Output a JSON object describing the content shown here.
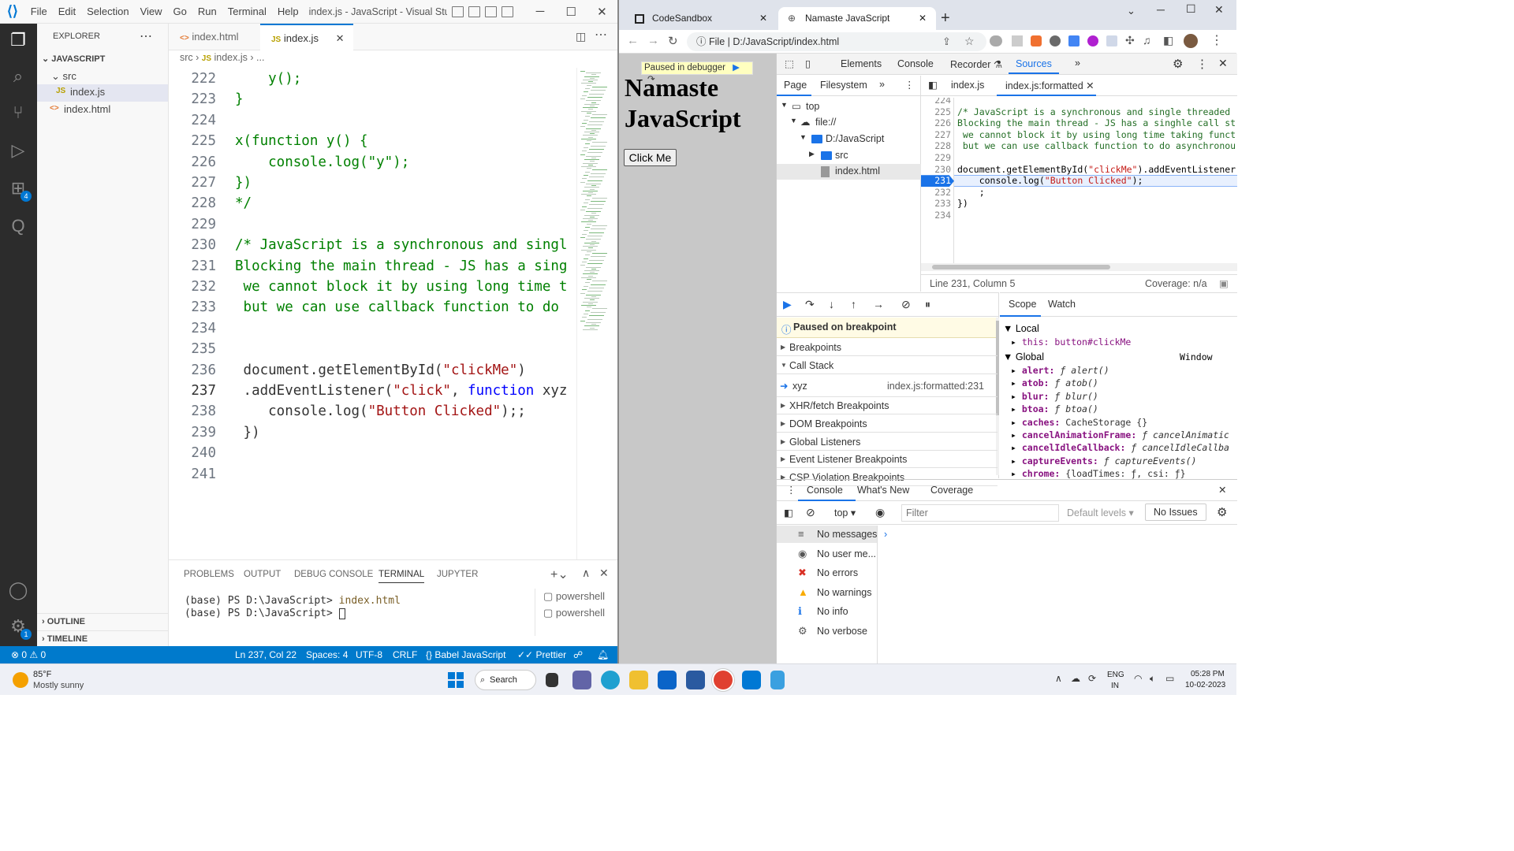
{
  "vscode": {
    "menu": [
      "File",
      "Edit",
      "Selection",
      "View",
      "Go",
      "Run",
      "Terminal",
      "Help"
    ],
    "window_title": "index.js - JavaScript - Visual Studio ...",
    "explorer_title": "EXPLORER",
    "workspace": "JAVASCRIPT",
    "folder": "src",
    "files": [
      "index.js",
      "index.html"
    ],
    "outline": "OUTLINE",
    "timeline": "TIMELINE",
    "badges": {
      "extensions": "4",
      "settings": "1"
    },
    "tabs": [
      {
        "label": "index.html",
        "icon": "<>"
      },
      {
        "label": "index.js",
        "icon": "JS"
      }
    ],
    "breadcrumb": {
      "folder": "src",
      "file": "index.js",
      "rest": "..."
    },
    "code_lines": [
      {
        "n": "222",
        "text": "    y();"
      },
      {
        "n": "223",
        "text": "}"
      },
      {
        "n": "224",
        "text": ""
      },
      {
        "n": "225",
        "text": "x(function y() {"
      },
      {
        "n": "226",
        "text": "    console.log(\"y\");"
      },
      {
        "n": "227",
        "text": "})"
      },
      {
        "n": "228",
        "text": "*/"
      },
      {
        "n": "229",
        "text": ""
      },
      {
        "n": "230",
        "text": "/* JavaScript is a synchronous and singl"
      },
      {
        "n": "231",
        "text": "Blocking the main thread - JS has a sing"
      },
      {
        "n": "232",
        "text": " we cannot block it by using long time t"
      },
      {
        "n": "233",
        "text": " but we can use callback function to do"
      },
      {
        "n": "234",
        "text": ""
      },
      {
        "n": "235",
        "text": ""
      },
      {
        "n": "236",
        "text": " document.getElementById(\"clickMe\")"
      },
      {
        "n": "237",
        "text": " .addEventListener(\"click\", function xyz"
      },
      {
        "n": "238",
        "text": "    console.log(\"Button Clicked\");;"
      },
      {
        "n": "239",
        "text": " })"
      },
      {
        "n": "240",
        "text": ""
      },
      {
        "n": "241",
        "text": ""
      }
    ],
    "panel_tabs": [
      "PROBLEMS",
      "OUTPUT",
      "DEBUG CONSOLE",
      "TERMINAL",
      "JUPYTER"
    ],
    "terminal_lines": [
      {
        "prompt": "(base) PS D:\\JavaScript>",
        "cmd": "index.html"
      },
      {
        "prompt": "(base) PS D:\\JavaScript>",
        "cmd": ""
      }
    ],
    "terminal_instances": [
      "powershell",
      "powershell"
    ],
    "status": {
      "errors": "0",
      "warnings": "0",
      "position": "Ln 237, Col 22",
      "spaces": "Spaces: 4",
      "encoding": "UTF-8",
      "eol": "CRLF",
      "language": "Babel JavaScript",
      "formatter": "Prettier"
    }
  },
  "chrome": {
    "tabs": [
      {
        "label": "CodeSandbox"
      },
      {
        "label": "Namaste JavaScript"
      }
    ],
    "url_scheme": "File",
    "url": "D:/JavaScript/index.html",
    "page": {
      "paused_banner": "Paused in debugger",
      "heading": "Namaste JavaScript",
      "button": "Click Me"
    },
    "devtools": {
      "tabs": [
        "Elements",
        "Console",
        "Recorder",
        "Sources"
      ],
      "nav_tabs": [
        "Page",
        "Filesystem"
      ],
      "tree": [
        "top",
        "file://",
        "D:/JavaScript",
        "src",
        "index.html"
      ],
      "file_tabs": [
        "index.js",
        "index.js:formatted"
      ],
      "src_lines": [
        {
          "n": "224",
          "text": ""
        },
        {
          "n": "225",
          "text": "/* JavaScript is a synchronous and single threaded"
        },
        {
          "n": "226",
          "text": "Blocking the main thread - JS has a singhle call st"
        },
        {
          "n": "227",
          "text": " we cannot block it by using long time taking funct"
        },
        {
          "n": "228",
          "text": " but we can use callback function to do asynchronou"
        },
        {
          "n": "229",
          "text": ""
        },
        {
          "n": "230",
          "text": "document.getElementById(\"clickMe\").addEventListener"
        },
        {
          "n": "231",
          "text": "    console.log(\"Button Clicked\");"
        },
        {
          "n": "232",
          "text": "    ;"
        },
        {
          "n": "233",
          "text": "})"
        },
        {
          "n": "234",
          "text": ""
        }
      ],
      "cursor_status": "Line 231, Column 5",
      "coverage": "Coverage: n/a",
      "paused_msg": "Paused on breakpoint",
      "sections": [
        "Breakpoints",
        "Call Stack",
        "XHR/fetch Breakpoints",
        "DOM Breakpoints",
        "Global Listeners",
        "Event Listener Breakpoints",
        "CSP Violation Breakpoints"
      ],
      "call_stack_frame": {
        "name": "xyz",
        "location": "index.js:formatted:231"
      },
      "scope_tabs": [
        "Scope",
        "Watch"
      ],
      "scope": {
        "local_label": "Local",
        "this_key": "this:",
        "this_val": "button#clickMe",
        "global_label": "Global",
        "global_val": "Window",
        "entries": [
          {
            "k": "alert:",
            "v": "ƒ alert()"
          },
          {
            "k": "atob:",
            "v": "ƒ atob()"
          },
          {
            "k": "blur:",
            "v": "ƒ blur()"
          },
          {
            "k": "btoa:",
            "v": "ƒ btoa()"
          },
          {
            "k": "caches:",
            "v": "CacheStorage {}"
          },
          {
            "k": "cancelAnimationFrame:",
            "v": "ƒ cancelAnimatic"
          },
          {
            "k": "cancelIdleCallback:",
            "v": "ƒ cancelIdleCallba"
          },
          {
            "k": "captureEvents:",
            "v": "ƒ captureEvents()"
          },
          {
            "k": "chrome:",
            "v": "{loadTimes: ƒ, csi: ƒ}"
          }
        ]
      },
      "drawer_tabs": [
        "Console",
        "What's New",
        "Coverage"
      ],
      "console_context": "top",
      "filter_placeholder": "Filter",
      "levels": "Default levels",
      "issues": "No Issues",
      "message_filters": [
        "No messages",
        "No user me...",
        "No errors",
        "No warnings",
        "No info",
        "No verbose"
      ]
    }
  },
  "taskbar": {
    "weather_temp": "85°F",
    "weather_desc": "Mostly sunny",
    "search": "Search",
    "lang": "ENG",
    "region": "IN",
    "time": "05:28 PM",
    "date": "10-02-2023"
  },
  "colors": {
    "accent": "#007acc",
    "comment": "#008000",
    "string": "#a31515",
    "keyword": "#0000ff",
    "breakpoint": "#1a73e8"
  }
}
